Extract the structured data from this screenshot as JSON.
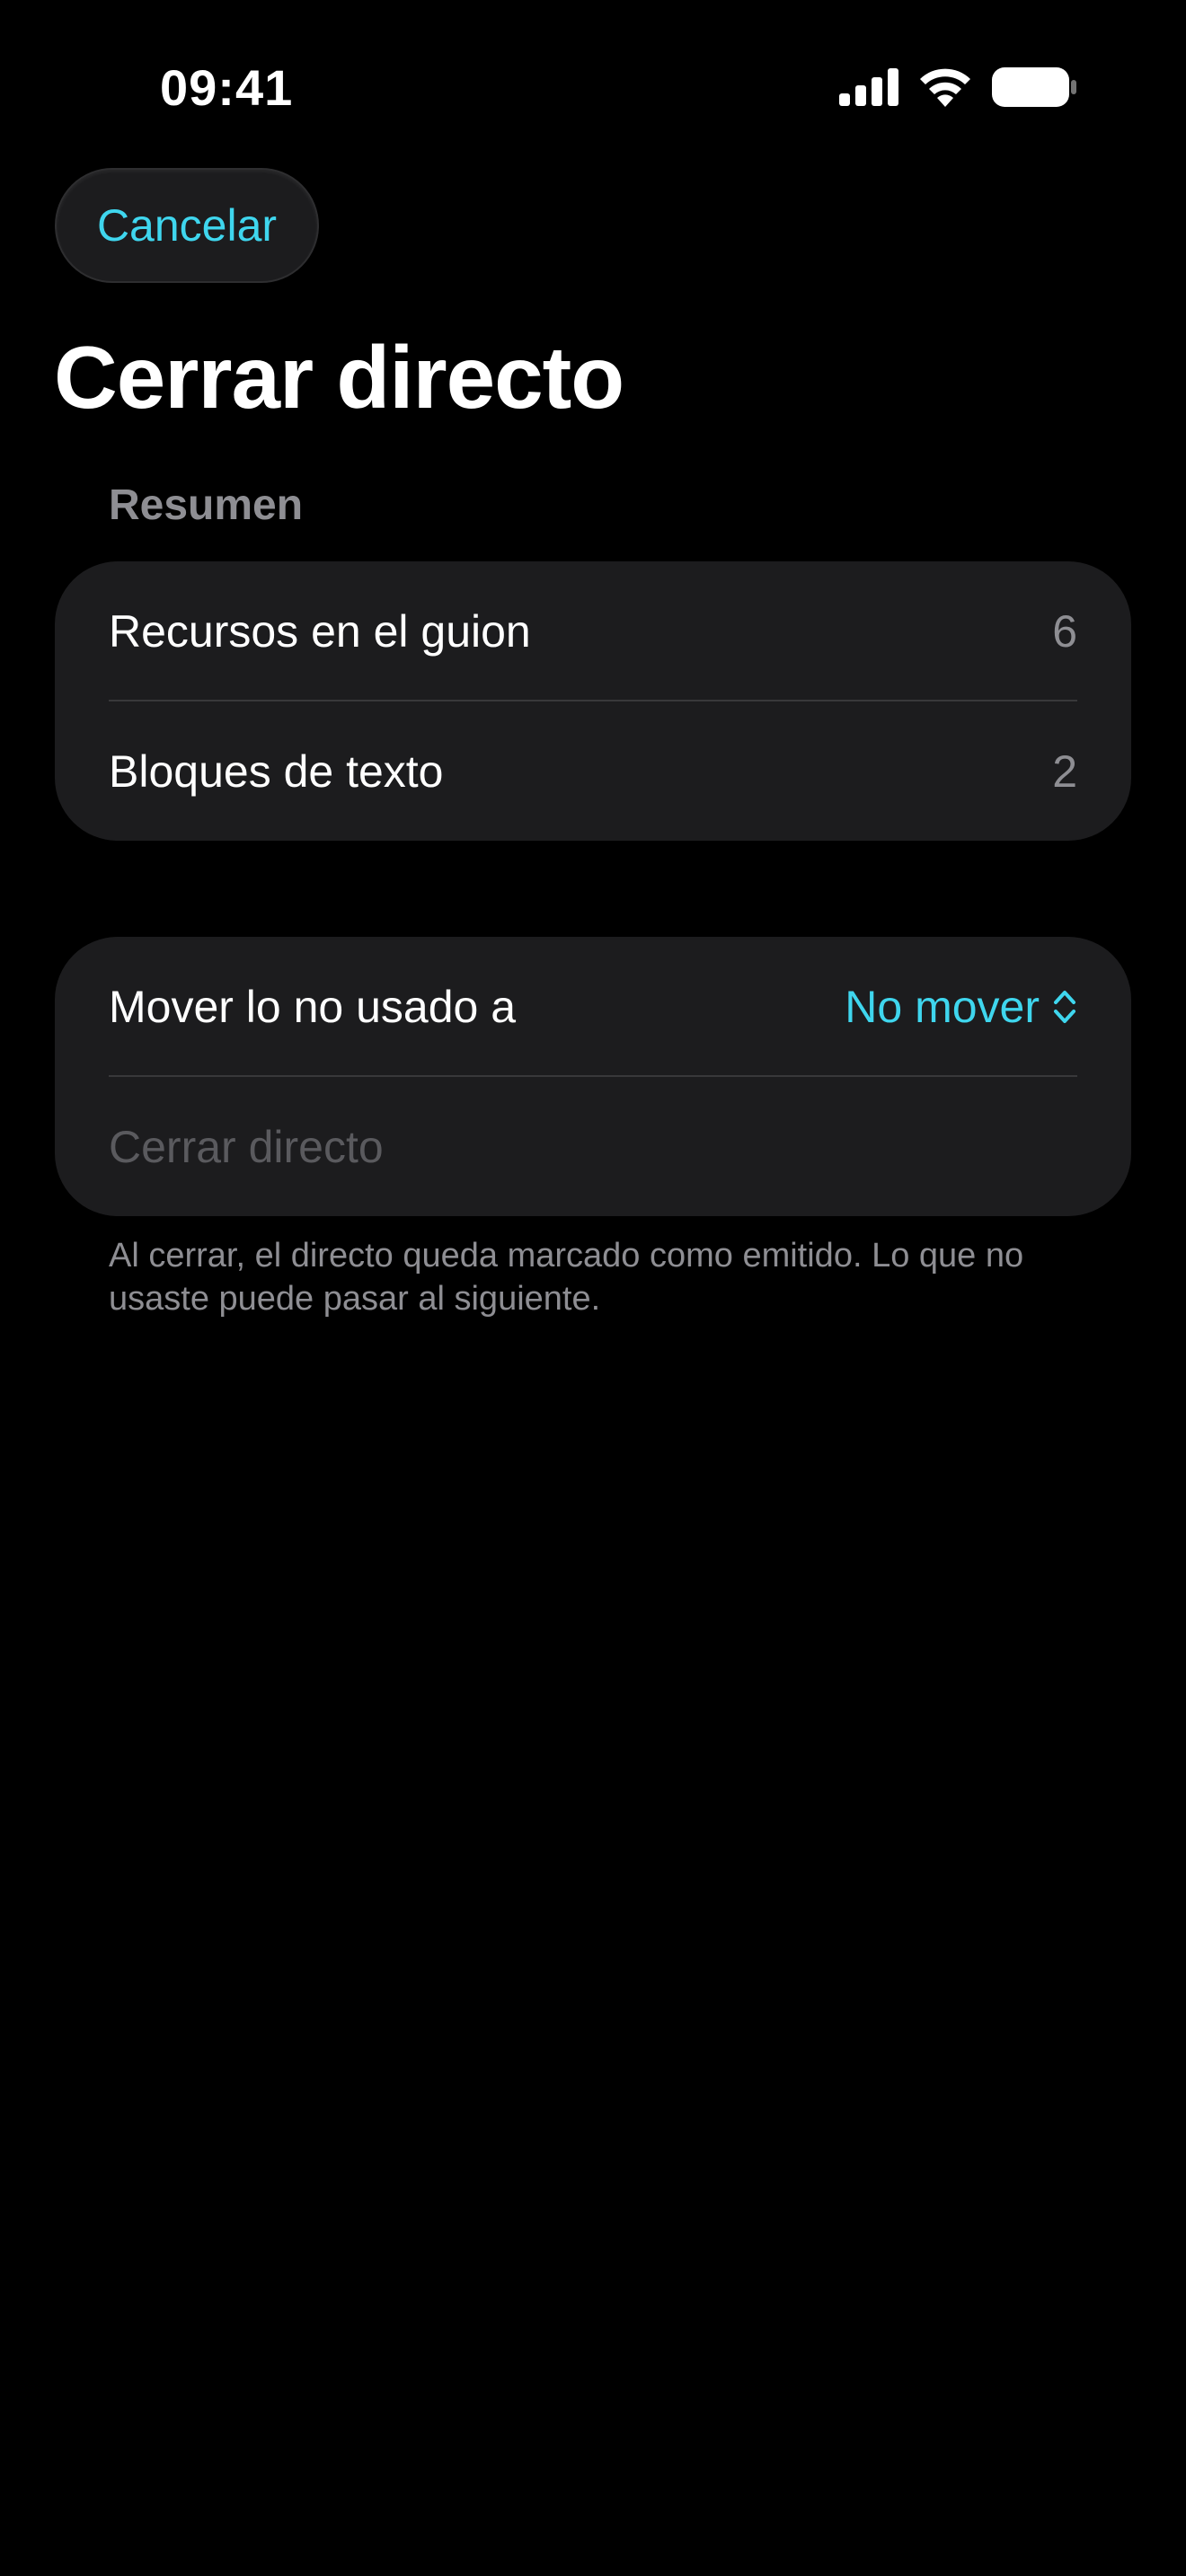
{
  "status_bar": {
    "time": "09:41",
    "icons": [
      "signal-icon",
      "wifi-icon",
      "battery-icon"
    ]
  },
  "nav": {
    "cancel_label": "Cancelar"
  },
  "title": "Cerrar directo",
  "summary": {
    "header": "Resumen",
    "rows": [
      {
        "label": "Recursos en el guion",
        "value": "6"
      },
      {
        "label": "Bloques de texto",
        "value": "2"
      }
    ]
  },
  "move": {
    "label": "Mover lo no usado a",
    "selected_option": "No mover",
    "action_label": "Cerrar directo",
    "footnote": "Al cerrar, el directo queda marcado como emitido. Lo que no usaste puede pasar al siguiente."
  },
  "colors": {
    "background": "#000000",
    "card": "#1c1c1e",
    "accent": "#3fd6ee",
    "secondary_text": "#8e8e93",
    "disabled_text": "#5a5a5e"
  }
}
